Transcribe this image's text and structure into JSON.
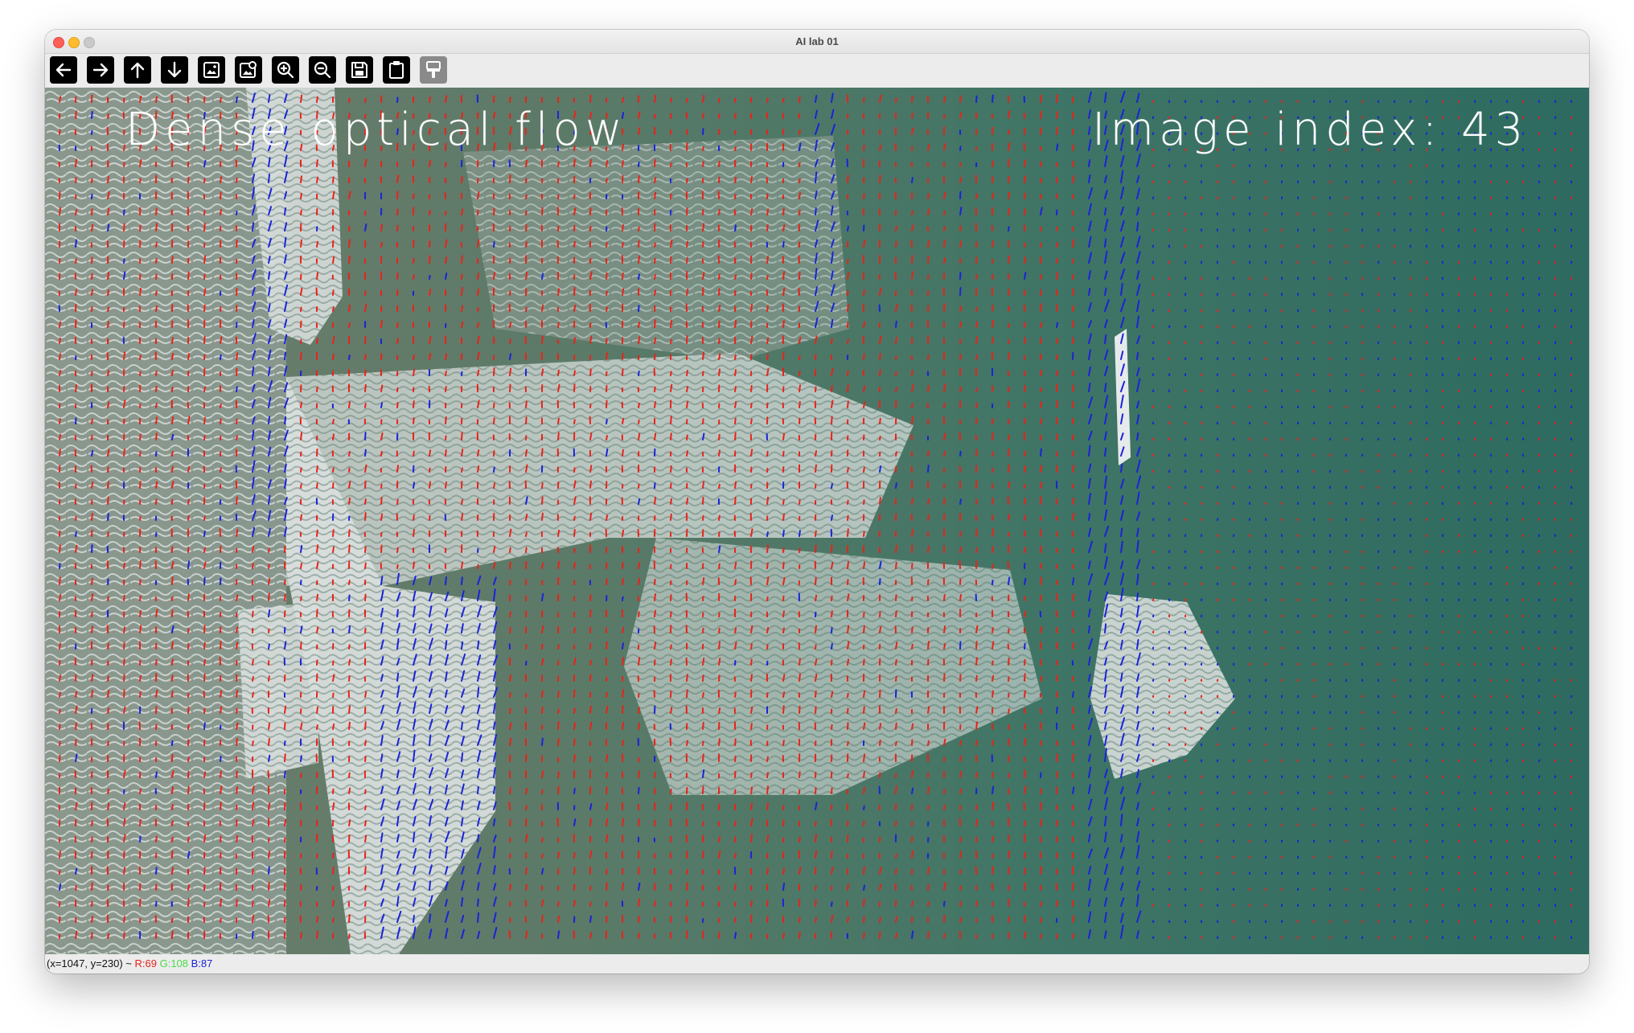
{
  "window": {
    "title": "AI lab 01"
  },
  "toolbar": {
    "buttons": [
      {
        "name": "pan-left-button",
        "icon": "arrow-left-icon"
      },
      {
        "name": "pan-right-button",
        "icon": "arrow-right-icon"
      },
      {
        "name": "pan-up-button",
        "icon": "arrow-up-icon"
      },
      {
        "name": "pan-down-button",
        "icon": "arrow-down-icon"
      },
      {
        "name": "zoom-actual-size-button",
        "icon": "image-icon"
      },
      {
        "name": "zoom-fit-button",
        "icon": "image-fit-icon"
      },
      {
        "name": "zoom-in-button",
        "icon": "zoom-in-icon"
      },
      {
        "name": "zoom-out-button",
        "icon": "zoom-out-icon"
      },
      {
        "name": "save-image-button",
        "icon": "floppy-disk-icon"
      },
      {
        "name": "copy-to-clipboard-button",
        "icon": "clipboard-icon"
      },
      {
        "name": "properties-button",
        "icon": "paint-brush-icon",
        "disabled": true
      }
    ]
  },
  "overlay": {
    "left_label": "Dense optical flow",
    "right_label": "Image index: 43"
  },
  "status": {
    "coords": "(x=1047, y=230) ~ ",
    "r": "R:69",
    "g": "G:108",
    "b": "B:87"
  },
  "colors": {
    "water": "#3d7468",
    "deep_water": "#2f6e64",
    "foam": "#e8ecec",
    "flow_red": "#e8231a",
    "flow_blue": "#1a23d8"
  }
}
